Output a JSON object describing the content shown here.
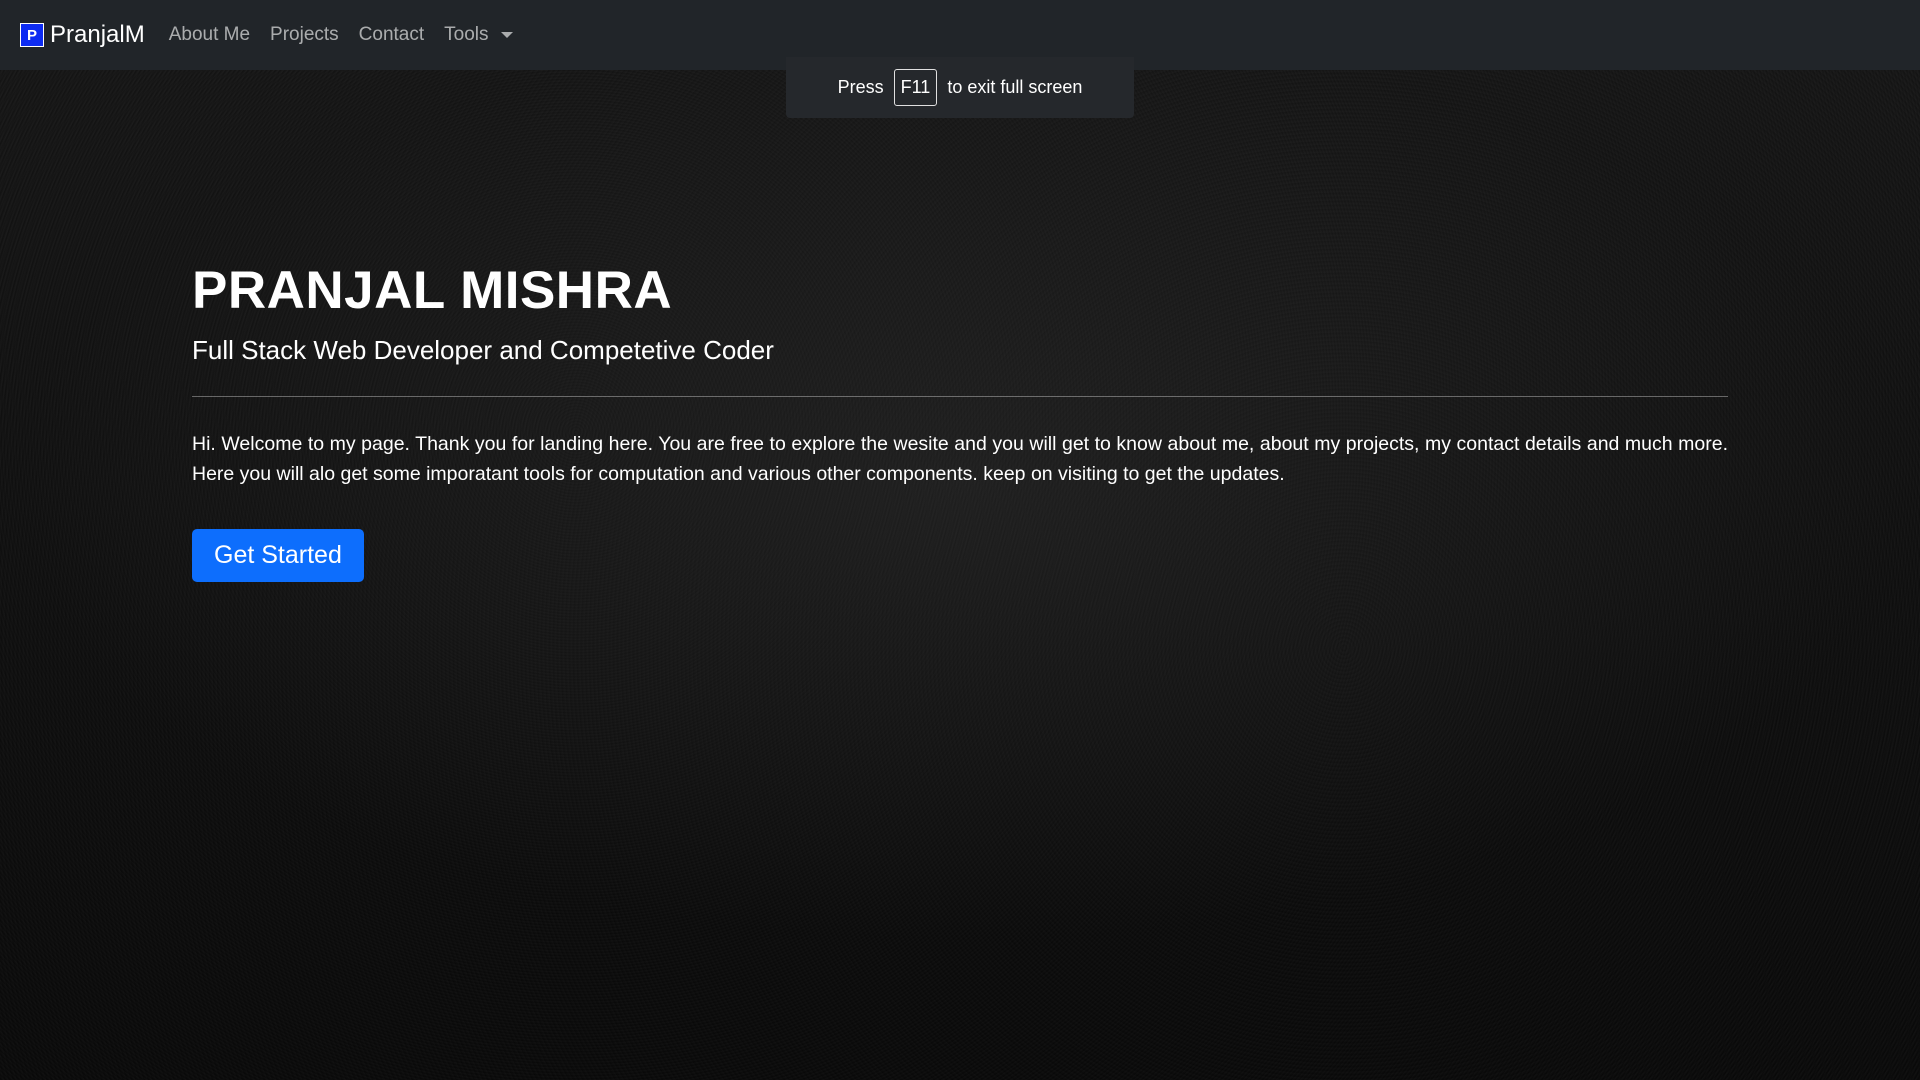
{
  "navbar": {
    "logo_letter": "P",
    "brand": "PranjalM",
    "links": [
      "About Me",
      "Projects",
      "Contact",
      "Tools"
    ]
  },
  "fullscreen_notice": {
    "prefix": "Press",
    "key": "F11",
    "suffix": "to exit full screen"
  },
  "hero": {
    "title": "PRANJAL MISHRA",
    "subtitle": "Full Stack Web Developer and Competetive Coder",
    "body": "Hi. Welcome to my page. Thank you for landing here. You are free to explore the wesite and you will get to know about me, about my projects, my contact details and much more. Here you will alo get some imporatant tools for computation and various other components. keep on visiting to get the updates.",
    "cta_label": "Get Started"
  },
  "colors": {
    "navbar_bg": "#212529",
    "accent": "#0d6efd",
    "logo_bg": "#0d2bf2"
  }
}
